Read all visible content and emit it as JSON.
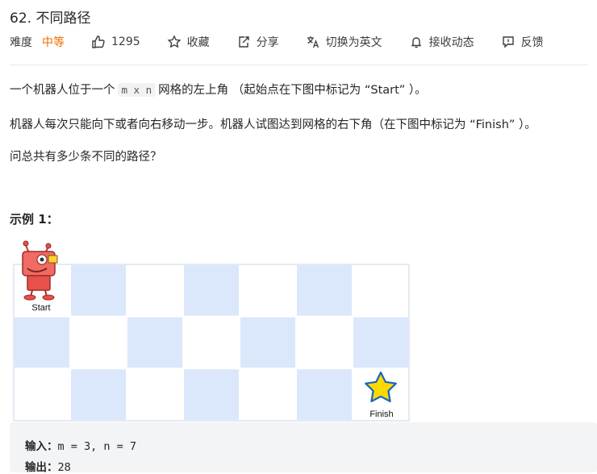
{
  "problem": {
    "title": "62. 不同路径",
    "difficulty_label": "难度",
    "difficulty": "中等",
    "likes": "1295",
    "actions": {
      "favorite": "收藏",
      "share": "分享",
      "translate": "切换为英文",
      "notify": "接收动态",
      "feedback": "反馈"
    }
  },
  "description": {
    "p1_before": "一个机器人位于一个",
    "p1_code": "m x n",
    "p1_after": "网格的左上角 （起始点在下图中标记为 “Start” ）。",
    "p2": "机器人每次只能向下或者向右移动一步。机器人试图达到网格的右下角（在下图中标记为 “Finish” ）。",
    "p3": "问总共有多少条不同的路径？"
  },
  "example": {
    "heading": "示例 1：",
    "start_label": "Start",
    "finish_label": "Finish",
    "input_label": "输入：",
    "input_value": "m = 3, n = 7",
    "output_label": "输出：",
    "output_value": "28"
  },
  "grid": {
    "rows": 3,
    "cols": 7,
    "blue_color": "#dbe7fb",
    "white_color": "#ffffff"
  },
  "colors": {
    "accent_difficulty": "#ef6c00",
    "robot_red": "#e8504a",
    "star_yellow": "#ffd900",
    "star_blue": "#1565c0"
  }
}
